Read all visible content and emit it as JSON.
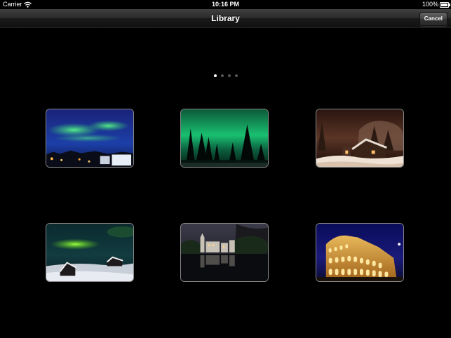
{
  "status_bar": {
    "carrier": "Carrier",
    "time": "10:16 PM",
    "battery": "100%"
  },
  "nav": {
    "title": "Library",
    "cancel_label": "Cancel"
  },
  "pager": {
    "pages": 4,
    "current": 1
  },
  "photos": [
    {
      "subject": "aurora over town"
    },
    {
      "subject": "green aurora behind pines"
    },
    {
      "subject": "snowy cabin at night"
    },
    {
      "subject": "aurora over snowy huts"
    },
    {
      "subject": "castle reflected at night"
    },
    {
      "subject": "illuminated colosseum"
    }
  ]
}
